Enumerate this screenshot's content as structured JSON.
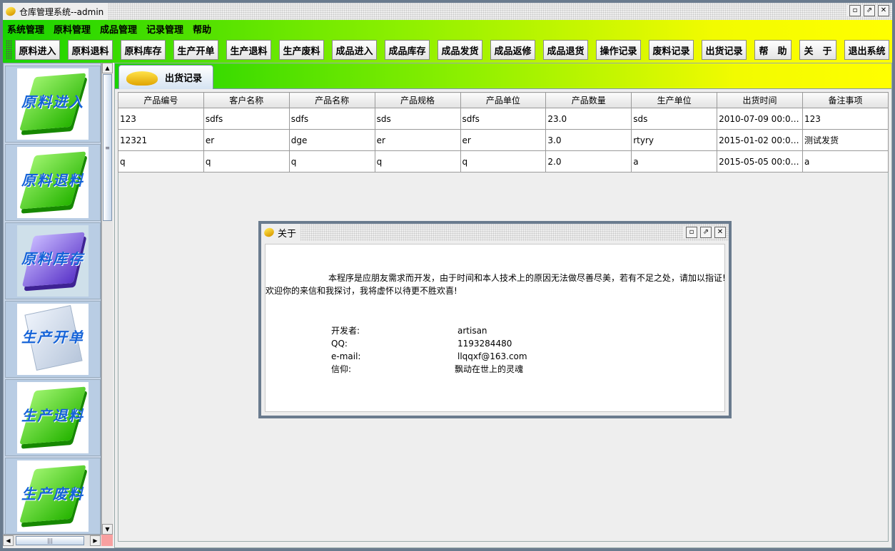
{
  "window": {
    "title": "仓库管理系统--admin"
  },
  "menu": [
    "系统管理",
    "原料管理",
    "成品管理",
    "记录管理",
    "帮助"
  ],
  "toolbar": [
    "原料进入",
    "原料退料",
    "原料库存",
    "生产开单",
    "生产退料",
    "生产废料",
    "成品进入",
    "成品库存",
    "成品发货",
    "成品返修",
    "成品退货",
    "操作记录",
    "废料记录",
    "出货记录",
    "帮　助",
    "关　于",
    "退出系统"
  ],
  "sidebar": [
    "原料进入",
    "原料退料",
    "原料库存",
    "生产开单",
    "生产退料",
    "生产废料"
  ],
  "tab": {
    "label": "出货记录"
  },
  "table": {
    "columns": [
      "产品编号",
      "客户名称",
      "产品名称",
      "产品规格",
      "产品单位",
      "产品数量",
      "生产单位",
      "出货时间",
      "备注事项"
    ],
    "rows": [
      [
        "123",
        "sdfs",
        "sdfs",
        "sds",
        "sdfs",
        "23.0",
        "sds",
        "2010-07-09 00:00:0...",
        "123"
      ],
      [
        "12321",
        "er",
        "dge",
        "er",
        "er",
        "3.0",
        "rtyry",
        "2015-01-02 00:00:0...",
        "测试发货"
      ],
      [
        "q",
        "q",
        "q",
        "q",
        "q",
        "2.0",
        "a",
        "2015-05-05 00:00:0...",
        "a"
      ]
    ]
  },
  "dialog": {
    "title": "关于",
    "line1": "本程序是应朋友需求而开发，由于时间和本人技术上的原因无法做尽善尽美，若有不足之处，请加以指证!",
    "line2": "欢迎你的来信和我探讨，我将虚怀以待更不胜欢喜!",
    "dev_label": "开发者:",
    "dev_value": "artisan",
    "qq_label": "QQ:",
    "qq_value": "1193284480",
    "email_label": "e-mail:",
    "email_value": "llqqxf@163.com",
    "motto_label": "信仰:",
    "motto_value": "飘动在世上的灵魂"
  },
  "colors": {
    "bar_start": "#18d300",
    "bar_end": "#ffff00",
    "frame": "#6a7b8e"
  }
}
